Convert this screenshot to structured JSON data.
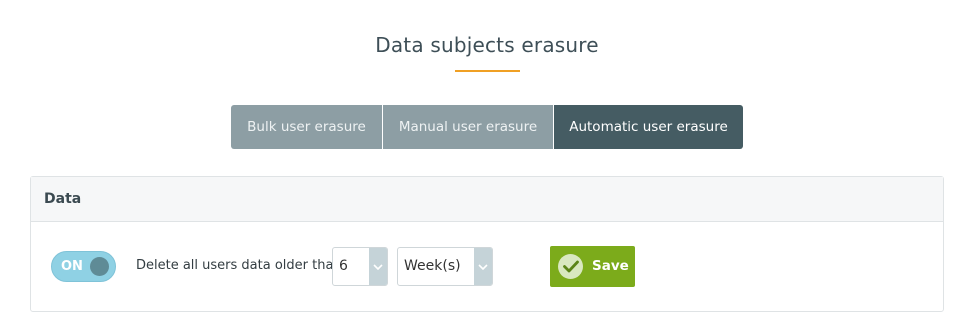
{
  "page": {
    "title": "Data subjects erasure"
  },
  "tabs": [
    {
      "label": "Bulk user erasure",
      "active": false
    },
    {
      "label": "Manual user erasure",
      "active": false
    },
    {
      "label": "Automatic user erasure",
      "active": true
    }
  ],
  "panel": {
    "header": "Data",
    "toggle": {
      "label": "ON",
      "state": "on"
    },
    "delete_label": "Delete all users data older than",
    "amount_select": {
      "value": "6"
    },
    "unit_select": {
      "value": "Week(s)"
    },
    "save_label": "Save"
  },
  "colors": {
    "accent_underline": "#f0a024",
    "active_tab": "#455c63",
    "inactive_tab": "#8d9ea4",
    "toggle_on": "#8fd1e4",
    "save_green": "#7cab1b"
  }
}
